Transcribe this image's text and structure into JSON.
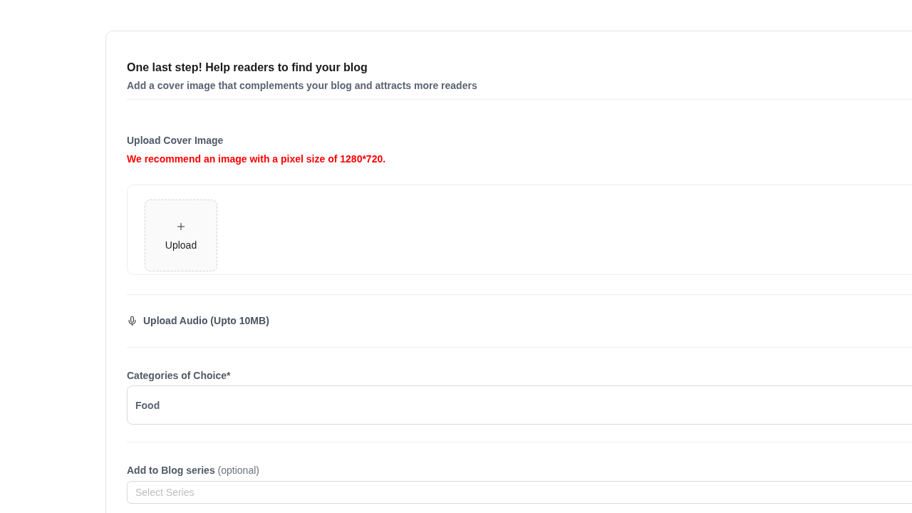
{
  "header": {
    "title": "One last step! Help readers to find your blog",
    "subtitle": "Add a cover image that complements your blog and attracts more readers"
  },
  "cover_image": {
    "label": "Upload Cover Image",
    "recommendation": "We recommend an image with a pixel size of 1280*720.",
    "upload_button": {
      "label": "Upload"
    }
  },
  "audio_upload": {
    "label": "Upload Audio (Upto 10MB)"
  },
  "categories": {
    "label": "Categories of Choice*",
    "value": "Food"
  },
  "blog_series": {
    "label": "**Add to Blog series** (optional)",
    "placeholder": "Select Series"
  }
}
